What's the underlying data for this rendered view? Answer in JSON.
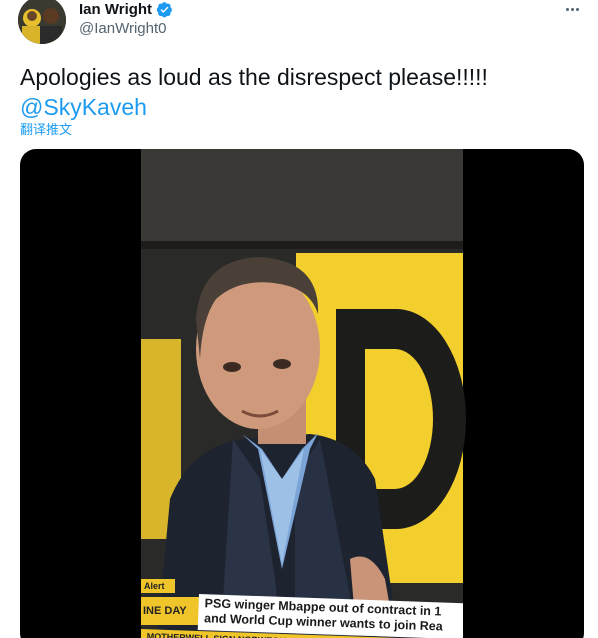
{
  "author": {
    "display_name": "Ian Wright",
    "handle": "@IanWright0",
    "verified": true
  },
  "tweet": {
    "text": "Apologies as loud as the disrespect please!!!!!",
    "mention": "@SkyKaveh",
    "translate_label": "翻译推文"
  },
  "media": {
    "alert_label": "Alert",
    "show_label": "INE DAY",
    "headline_line1": "PSG winger Mbappe out of contract in 1",
    "headline_line2": "and World Cup winner wants to join Rea",
    "sub_ticker": "MOTHERWELL SIGN NORWEGIAN DEFENDER SONDRE"
  },
  "icons": {
    "verified": "verified-badge-icon",
    "more": "more-options-icon"
  },
  "colors": {
    "accent": "#1d9bf0",
    "text": "#0f1419",
    "secondary": "#536471",
    "studio_yellow": "#f0c52a"
  }
}
